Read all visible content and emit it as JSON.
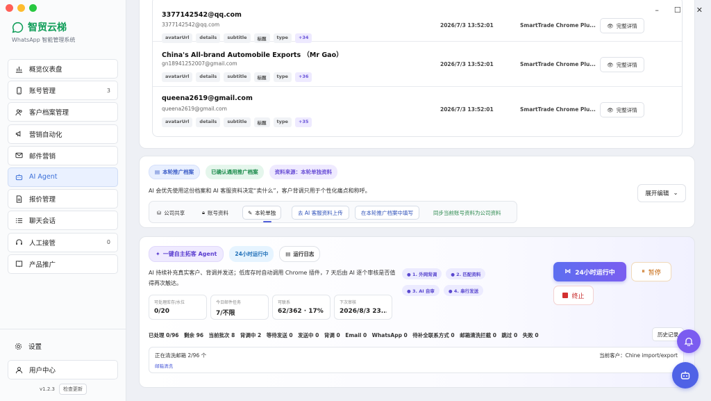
{
  "brand": {
    "name": "智贸云梯",
    "subtitle": "WhatsApp 智能管理系统",
    "accent": "#0f9d58"
  },
  "nav": [
    {
      "label": "概览仪表盘",
      "icon": "bar-chart-icon",
      "count": ""
    },
    {
      "label": "账号管理",
      "icon": "phone-icon",
      "count": "3"
    },
    {
      "label": "客户档案管理",
      "icon": "users-icon",
      "count": ""
    },
    {
      "label": "营销自动化",
      "icon": "megaphone-icon",
      "count": ""
    },
    {
      "label": "邮件营销",
      "icon": "mail-icon",
      "count": ""
    },
    {
      "label": "AI Agent",
      "icon": "bot-icon",
      "count": "",
      "active": true
    },
    {
      "label": "报价管理",
      "icon": "document-icon",
      "count": ""
    },
    {
      "label": "聊天会话",
      "icon": "list-icon",
      "count": ""
    },
    {
      "label": "人工接管",
      "icon": "headset-icon",
      "count": "0"
    },
    {
      "label": "产品推广",
      "icon": "book-icon",
      "count": ""
    }
  ],
  "bottom_nav": {
    "settings": "设置",
    "user": "用户中心"
  },
  "version": {
    "text": "v1.2.3",
    "check": "检查更新"
  },
  "contacts": [
    {
      "name": "3377142542@qq.com",
      "email": "3377142542@qq.com",
      "tags": [
        "avatarUrl",
        "details",
        "subtitle",
        "标题",
        "type"
      ],
      "more": "+34",
      "time": "2026/7/3 13:52:01",
      "source": "SmartTrade Chrome Plu...",
      "detail": "完整详情"
    },
    {
      "name": "China's All-brand Automobile Exports （Mr Gao）",
      "email": "gn18941252007@gmail.com",
      "tags": [
        "avatarUrl",
        "details",
        "subtitle",
        "标题",
        "type"
      ],
      "more": "+36",
      "time": "2026/7/3 13:52:01",
      "source": "SmartTrade Chrome Plu...",
      "detail": "完整详情"
    },
    {
      "name": "queena2619@gmail.com",
      "email": "queena2619@gmail.com",
      "tags": [
        "avatarUrl",
        "details",
        "subtitle",
        "标题",
        "type"
      ],
      "more": "+35",
      "time": "2026/7/3 13:52:01",
      "source": "SmartTrade Chrome Plu...",
      "detail": "完整详情"
    }
  ],
  "promo": {
    "chip_main": "本轮推广档案",
    "chip_confirmed": "已确认通用推广档案",
    "chip_source": "资料来源：本轮单独资料",
    "desc": "AI 会优先使用这份档案和 AI 客服资料决定“卖什么”，客户背调只用于个性化痛点和称呼。",
    "expand": "展开编辑",
    "segments": [
      "公司共享",
      "账号资料",
      "本轮单独"
    ],
    "actions": [
      "去 AI 客服资料上传",
      "在本轮推广档案中填写"
    ],
    "sync": "同步当前账号资料为公司资料"
  },
  "agent": {
    "chip_main": "一键自主拓客 Agent",
    "chip_run": "24小时运行中",
    "chip_log": "运行日志",
    "desc": "AI 持续补充真实客户、背调并发送；低库存时自动调用 Chrome 插件，7 天后由 AI 逐个审核是否值得再次触达。",
    "steps": [
      "1. 外网背调",
      "2. 匹配资料",
      "3. AI 自审",
      "4. 串行发送"
    ],
    "run_btn": "24小时运行中",
    "pause_btn": "暂停",
    "stop_btn": "终止",
    "stats": [
      {
        "k": "可处理库存/水位",
        "v": "0/20"
      },
      {
        "k": "今日邮件任务",
        "v": "7/不限"
      },
      {
        "k": "可联系",
        "v": "62/362 · 17%"
      },
      {
        "k": "下次审核",
        "v": "2026/8/3 23..."
      }
    ],
    "summary": "已处理 0/96　剩余 96　当前批次 8　背调中 2　等待发送 0　发送中 0　背调 0　Email 0　WhatsApp 0　待补全联系方式 0　邮箱清洗拦截 0　跳过 0　失败 0",
    "history": "历史记录",
    "progress_text": "正在清洗邮箱 2/96 个",
    "progress_link": "邮箱清洗",
    "current_customer": "当前客户：Chine import/export"
  },
  "window_controls": {
    "minimize": "–",
    "maximize": "☐",
    "close": "✕"
  }
}
